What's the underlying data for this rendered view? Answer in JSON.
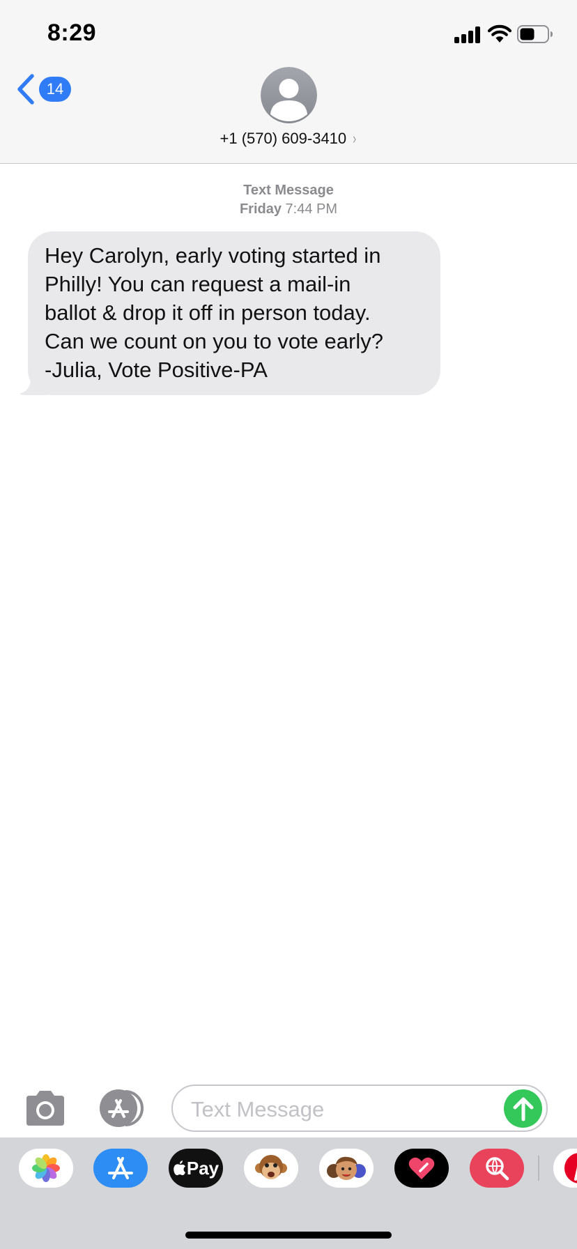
{
  "status_bar": {
    "time": "8:29"
  },
  "header": {
    "back_count": "14",
    "contact": "+1 (570) 609-3410",
    "contact_chevron": "›"
  },
  "conversation": {
    "service": "Text Message",
    "day": "Friday",
    "time": "7:44 PM",
    "messages": [
      {
        "direction": "incoming",
        "lines": [
          "Hey Carolyn, early voting started in",
          "Philly! You can request a mail-in",
          "ballot & drop it off in person today.",
          "Can we count on you to vote early?",
          "-Julia, Vote Positive-PA"
        ]
      }
    ]
  },
  "input_bar": {
    "placeholder": "Text Message",
    "icons": [
      "camera-icon",
      "app-store-icon",
      "send-arrow-icon"
    ]
  },
  "app_drawer": {
    "apps": [
      {
        "name": "photos",
        "icon": "photos-icon"
      },
      {
        "name": "app-store",
        "icon": "app-store-icon"
      },
      {
        "name": "apple-pay",
        "icon": "apple-pay-icon",
        "label": "Pay"
      },
      {
        "name": "animoji",
        "icon": "monkey-icon"
      },
      {
        "name": "memoji",
        "icon": "memoji-icon"
      },
      {
        "name": "digital-touch",
        "icon": "heart-icon"
      },
      {
        "name": "web-images",
        "icon": "globe-search-icon"
      },
      {
        "name": "pinterest",
        "icon": "pinterest-icon"
      }
    ]
  },
  "colors": {
    "accent_blue": "#2f7cf6",
    "send_green": "#34c759",
    "incoming_bubble": "#e9e9eb",
    "header_bg": "#f6f6f6",
    "drawer_bg": "#d3d5d9"
  }
}
